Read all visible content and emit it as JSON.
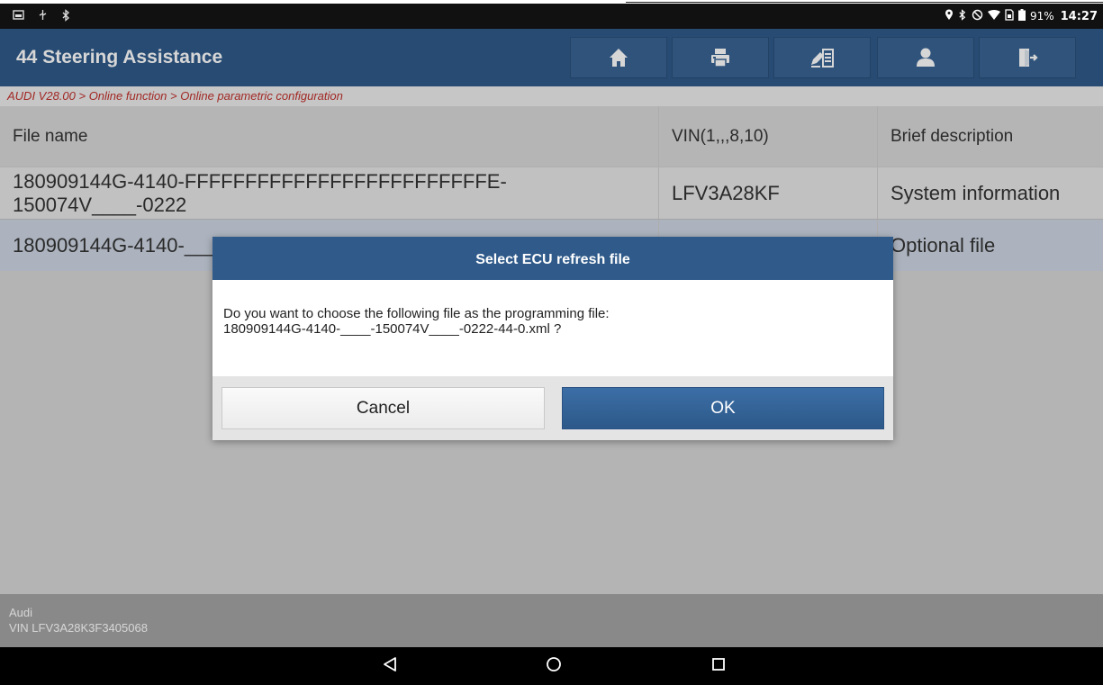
{
  "status_bar": {
    "left_icons": [
      "screen-icon",
      "usb-icon",
      "bluetooth-icon"
    ],
    "right_icons": [
      "location-icon",
      "bluetooth-icon",
      "dnd-icon",
      "wifi-icon",
      "sim-icon",
      "battery-icon"
    ],
    "battery": "91%",
    "time": "14:27"
  },
  "header": {
    "title": "44 Steering Assistance",
    "toolbar": [
      "home-icon",
      "print-icon",
      "edit-list-icon",
      "user-icon",
      "exit-icon"
    ],
    "color": "#2f5a8a"
  },
  "breadcrumb": "AUDI V28.00 > Online function > Online parametric configuration",
  "table": {
    "headers": [
      "File name",
      "VIN(1,,,8,10)",
      "Brief description"
    ],
    "rows": [
      [
        "180909144G-4140-FFFFFFFFFFFFFFFFFFFFFFFFFE-150074V____-0222",
        "LFV3A28KF",
        "System information"
      ],
      [
        "180909144G-4140-____",
        "",
        "Optional file"
      ]
    ]
  },
  "footer": {
    "make": "Audi",
    "vin": "VIN LFV3A28K3F3405068"
  },
  "dialog": {
    "title": "Select ECU refresh file",
    "message_line1": "Do you want to choose the following file as the programming file:",
    "message_line2": "180909144G-4140-____-150074V____-0222-44-0.xml ?",
    "cancel_label": "Cancel",
    "ok_label": "OK"
  },
  "nav_bar": [
    "back-icon",
    "home-circle-icon",
    "recents-icon"
  ]
}
